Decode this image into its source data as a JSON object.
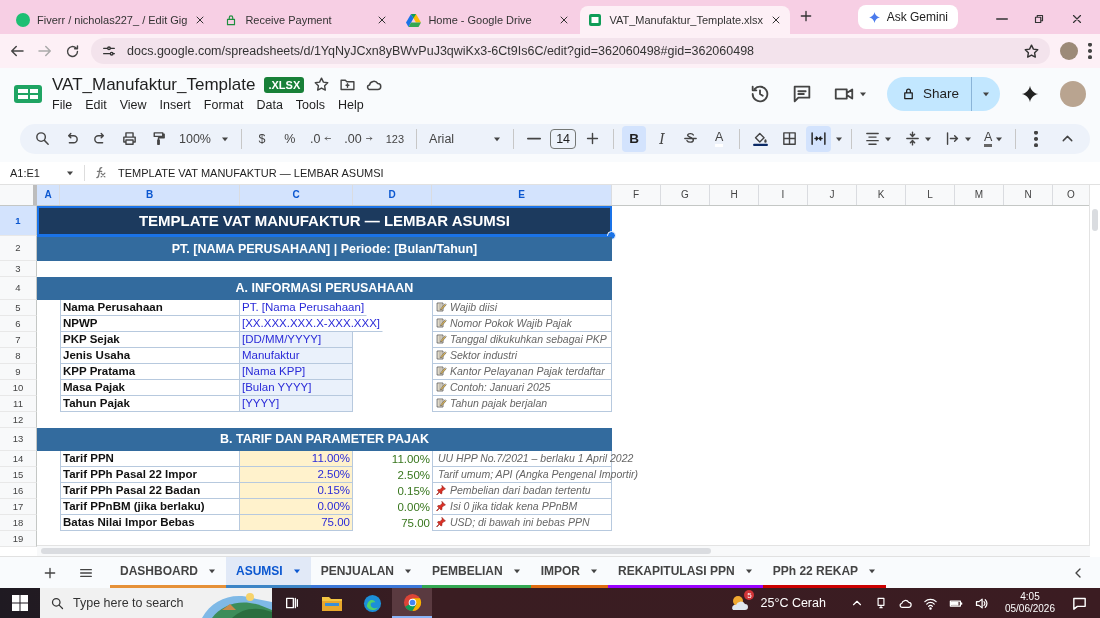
{
  "browser": {
    "tabs": [
      {
        "title": "Fiverr / nicholas227_ / Edit Gig",
        "selected": false
      },
      {
        "title": "Receive Payment",
        "selected": false
      },
      {
        "title": "Home - Google Drive",
        "selected": false
      },
      {
        "title": "VAT_Manufaktur_Template.xlsx",
        "selected": true
      }
    ],
    "ask_gemini": "Ask Gemini",
    "url": "docs.google.com/spreadsheets/d/1YqNyJCxn8yBWvPuJ3qwiKx3-6Ct9Is6C/edit?gid=362060498#gid=362060498"
  },
  "document": {
    "title": "VAT_Manufaktur_Template",
    "badge": ".XLSX",
    "menus": [
      "File",
      "Edit",
      "View",
      "Insert",
      "Format",
      "Data",
      "Tools",
      "Help"
    ],
    "share": "Share"
  },
  "toolbar": {
    "zoom": "100%",
    "currency": "$",
    "percent": "%",
    "decrease_decimals": ".0",
    "increase_decimals": ".00",
    "number_format": "123",
    "font": "Arial",
    "font_size": "14",
    "bold": {
      "label": "B",
      "selected": true
    },
    "italic": {
      "label": "I",
      "selected": false
    },
    "text_color": "A",
    "merge_cells": {
      "selected": true
    },
    "text_rotation": "A"
  },
  "name_box": "A1:E1",
  "formula": "TEMPLATE VAT MANUFAKTUR — LEMBAR ASUMSI",
  "columns": [
    {
      "label": "A",
      "selected": true
    },
    {
      "label": "B",
      "selected": true
    },
    {
      "label": "C",
      "selected": true
    },
    {
      "label": "D",
      "selected": true
    },
    {
      "label": "E",
      "selected": true
    },
    {
      "label": "F",
      "selected": false
    },
    {
      "label": "G",
      "selected": false
    },
    {
      "label": "H",
      "selected": false
    },
    {
      "label": "I",
      "selected": false
    },
    {
      "label": "J",
      "selected": false
    },
    {
      "label": "K",
      "selected": false
    },
    {
      "label": "L",
      "selected": false
    },
    {
      "label": "M",
      "selected": false
    },
    {
      "label": "N",
      "selected": false
    },
    {
      "label": "O",
      "selected": false
    }
  ],
  "rows": [
    {
      "number": "1",
      "selected": true,
      "kind": "title",
      "text": "TEMPLATE VAT MANUFAKTUR — LEMBAR ASUMSI"
    },
    {
      "number": "2",
      "selected": false,
      "kind": "subtitle",
      "text": "PT. [NAMA PERUSAHAAN] | Periode: [Bulan/Tahun]"
    },
    {
      "number": "3",
      "selected": false,
      "kind": "blank"
    },
    {
      "number": "4",
      "selected": false,
      "kind": "section",
      "text": "A. INFORMASI PERUSAHAAN"
    },
    {
      "number": "5",
      "selected": false,
      "kind": "info",
      "label": "Nama Perusahaan",
      "value": "PT. [Nama Perusahaan]",
      "filled": false,
      "note": "Wajib diisi"
    },
    {
      "number": "6",
      "selected": false,
      "kind": "info",
      "label": "NPWP",
      "value": "[XX.XXX.XXX.X-XXX.XXX]",
      "filled": false,
      "note": "Nomor Pokok Wajib Pajak"
    },
    {
      "number": "7",
      "selected": false,
      "kind": "info",
      "label": "PKP Sejak",
      "value": "[DD/MM/YYYY]",
      "filled": true,
      "note": "Tanggal dikukuhkan sebagai PKP"
    },
    {
      "number": "8",
      "selected": false,
      "kind": "info",
      "label": "Jenis Usaha",
      "value": "Manufaktur",
      "filled": true,
      "note": "Sektor industri"
    },
    {
      "number": "9",
      "selected": false,
      "kind": "info",
      "label": "KPP Pratama",
      "value": "[Nama KPP]",
      "filled": true,
      "note": "Kantor Pelayanan Pajak terdaftar"
    },
    {
      "number": "10",
      "selected": false,
      "kind": "info",
      "label": "Masa Pajak",
      "value": "[Bulan YYYY]",
      "filled": true,
      "note": "Contoh: Januari 2025"
    },
    {
      "number": "11",
      "selected": false,
      "kind": "info",
      "label": "Tahun Pajak",
      "value": "[YYYY]",
      "filled": true,
      "note": "Tahun pajak berjalan"
    },
    {
      "number": "12",
      "selected": false,
      "kind": "blank"
    },
    {
      "number": "13",
      "selected": false,
      "kind": "section",
      "text": "B. TARIF DAN PARAMETER PAJAK"
    },
    {
      "number": "14",
      "selected": false,
      "kind": "rate",
      "label": "Tarif PPN",
      "value": "11.00%",
      "check": "11.00%",
      "note": "UU HPP No.7/2021 – berlaku 1 April 2022"
    },
    {
      "number": "15",
      "selected": false,
      "kind": "rate",
      "label": "Tarif PPh Pasal 22 Impor",
      "value": "2.50%",
      "check": "2.50%",
      "note": "Tarif umum; API (Angka Pengenal Importir)"
    },
    {
      "number": "16",
      "selected": false,
      "kind": "rate",
      "label": "Tarif PPh Pasal 22 Badan",
      "value": "0.15%",
      "check": "0.15%",
      "note": "Pembelian dari badan tertentu"
    },
    {
      "number": "17",
      "selected": false,
      "kind": "rate",
      "label": "Tarif PPnBM (jika berlaku)",
      "value": "0.00%",
      "check": "0.00%",
      "note": "Isi 0 jika tidak kena PPnBM"
    },
    {
      "number": "18",
      "selected": false,
      "kind": "rate",
      "label": "Batas Nilai Impor Bebas",
      "value": "75.00",
      "check": "75.00",
      "note": "USD; di bawah ini bebas PPN"
    },
    {
      "number": "19",
      "selected": false,
      "kind": "blank"
    }
  ],
  "sheets": [
    {
      "label": "DASHBOARD",
      "selected": false,
      "color": "#e69138"
    },
    {
      "label": "ASUMSI",
      "selected": true,
      "color": "#3d85c6"
    },
    {
      "label": "PENJUALAN",
      "selected": false,
      "color": "#3c78d8"
    },
    {
      "label": "PEMBELIAN",
      "selected": false,
      "color": "#34a853"
    },
    {
      "label": "IMPOR",
      "selected": false,
      "color": "#e06c10"
    },
    {
      "label": "REKAPITULASI PPN",
      "selected": false,
      "color": "#9900ff"
    },
    {
      "label": "PPh 22 REKAP",
      "selected": false,
      "color": "#cc0000"
    }
  ],
  "taskbar": {
    "search_placeholder": "Type here to search",
    "weather_badge": "5",
    "weather": "25°C Cerah",
    "time": "4:05",
    "date": "05/06/2026"
  }
}
